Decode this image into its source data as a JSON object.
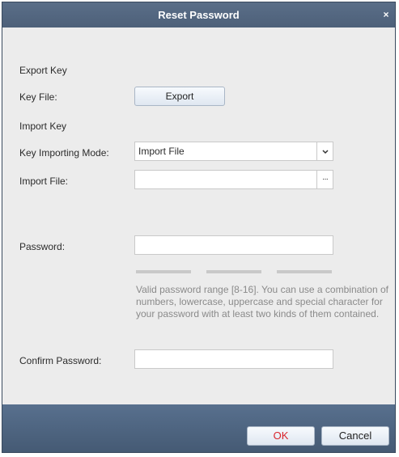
{
  "dialog": {
    "title": "Reset Password",
    "close_glyph": "×"
  },
  "export_section": {
    "heading": "Export Key",
    "key_file_label": "Key File:",
    "export_button": "Export"
  },
  "import_section": {
    "heading": "Import Key",
    "mode_label": "Key Importing Mode:",
    "mode_value": "Import File",
    "import_file_label": "Import File:",
    "import_file_value": "",
    "browse_glyph": "···"
  },
  "password": {
    "label": "Password:",
    "value": "",
    "strength_segments": 3,
    "hint": "Valid password range [8-16]. You can use a combination of numbers, lowercase, uppercase and special character for your password with at least two kinds of them contained."
  },
  "confirm": {
    "label": "Confirm Password:",
    "value": ""
  },
  "footer": {
    "ok_label": "OK",
    "cancel_label": "Cancel",
    "ok_color": "#d9242b"
  },
  "icons": {
    "close": "close-icon",
    "dropdown": "chevron-down-icon",
    "browse": "ellipsis-icon"
  }
}
